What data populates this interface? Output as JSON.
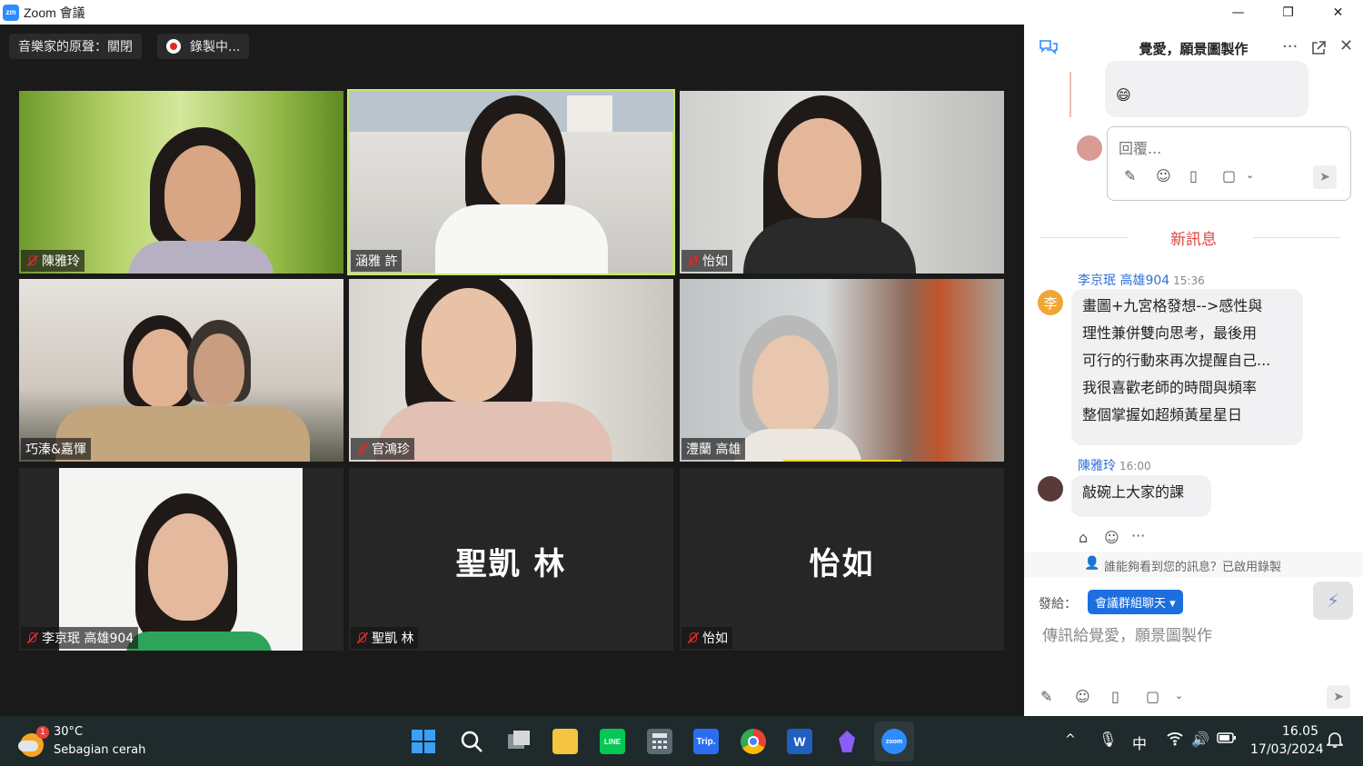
{
  "window": {
    "logo": "zm",
    "title": "Zoom 會議",
    "controls": [
      "—",
      "❐",
      "✕"
    ]
  },
  "meeting": {
    "music_mode": "音樂家的原聲：關閉",
    "recording": "錄製中..."
  },
  "participants": [
    {
      "name": "陳雅玲",
      "muted": true,
      "video": true,
      "active": false
    },
    {
      "name": "涵雅 許",
      "muted": false,
      "video": true,
      "active": true
    },
    {
      "name": "怡如",
      "muted": true,
      "video": true,
      "active": false
    },
    {
      "name": "巧溱&嘉惲",
      "muted": false,
      "video": true,
      "active": false
    },
    {
      "name": "官鴻珍",
      "muted": true,
      "video": true,
      "active": false
    },
    {
      "name": "澧蘭 高雄",
      "muted": false,
      "video": true,
      "active": false
    },
    {
      "name": "李京珉 高雄904",
      "muted": true,
      "video": true,
      "active": false
    },
    {
      "name": "聖凱 林",
      "big_label": "聖凱 林",
      "muted": true,
      "video": false,
      "active": false
    },
    {
      "name": "怡如",
      "big_label": "怡如",
      "muted": true,
      "video": false,
      "active": false
    }
  ],
  "chat": {
    "title": "覺愛，願景圖製作",
    "emoji": "😄",
    "reply_placeholder": "回覆...",
    "new_messages": "新訊息",
    "messages": [
      {
        "sender": "李京珉 高雄904",
        "time": "15:36",
        "avatar_text": "李",
        "lines": [
          "畫圖+九宮格發想-->感性與",
          "理性兼併雙向思考，最後用",
          "可行的行動來再次提醒自己...",
          "我很喜歡老師的時間與頻率",
          "整個掌握如超頻黃星星日"
        ]
      },
      {
        "sender": "陳雅玲",
        "time": "16:00",
        "lines": [
          "敲碗上大家的課"
        ]
      }
    ],
    "visibility": "誰能夠看到您的訊息？已啟用錄製",
    "to_label": "發給：",
    "to_target": "會議群組聊天",
    "input_placeholder": "傳訊給覺愛，願景圖製作"
  },
  "taskbar": {
    "weather_temp": "30°C",
    "weather_desc": "Sebagian cerah",
    "weather_badge": "1",
    "time": "16.05",
    "date": "17/03/2024",
    "ime": "中",
    "apps": [
      "start-icon",
      "search-icon",
      "task-view-icon",
      "file-explorer-icon",
      "line-icon",
      "calculator-icon",
      "trip-icon",
      "chrome-icon",
      "word-icon",
      "obsidian-icon",
      "zoom-icon"
    ],
    "line_label": "LINE",
    "trip_label": "Trip.",
    "word_label": "W",
    "zoom_label": "zoom"
  }
}
